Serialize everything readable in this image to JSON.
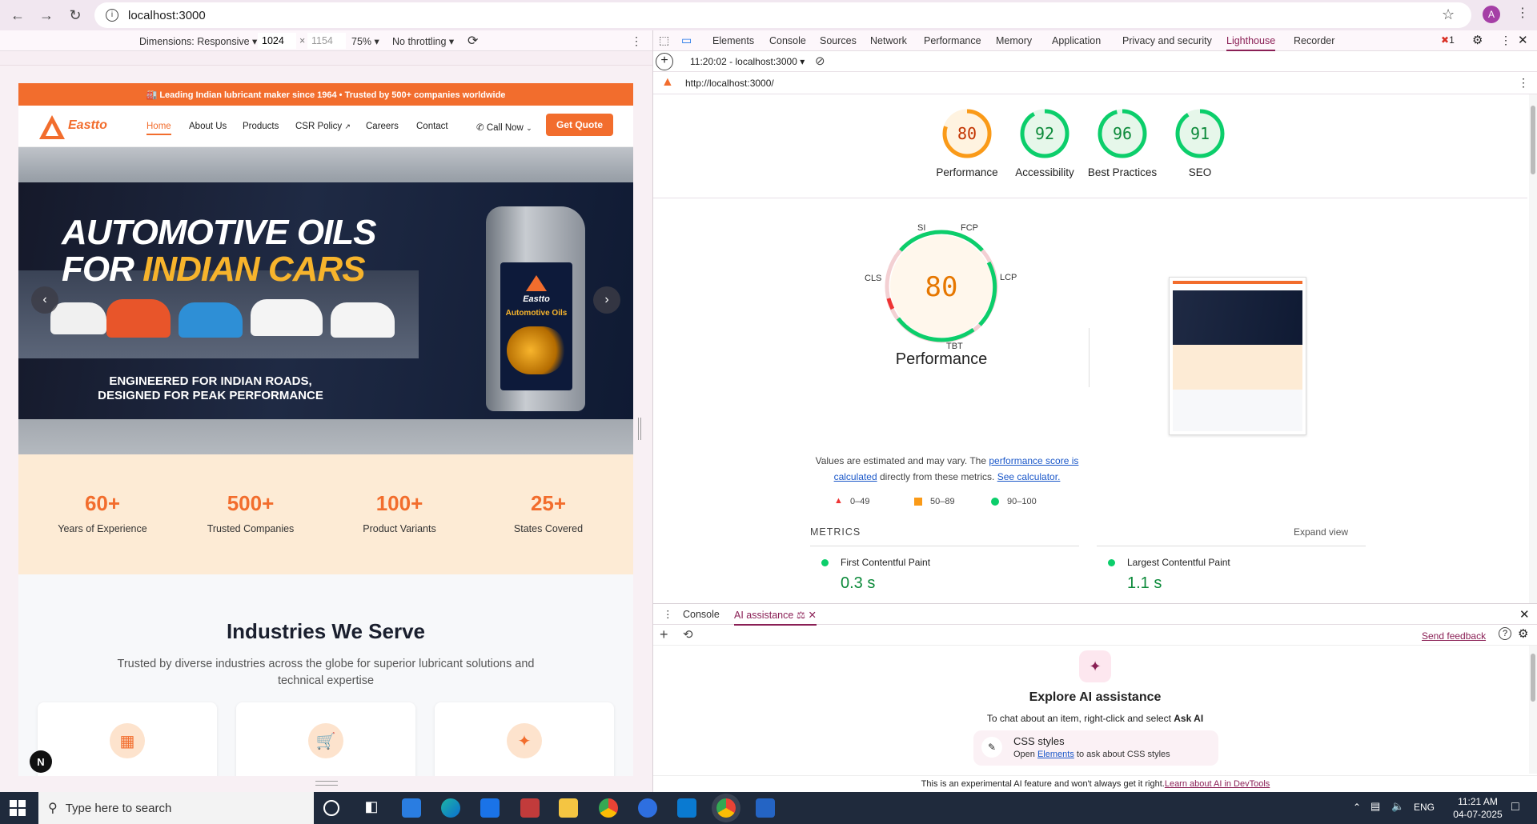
{
  "browser": {
    "url": "localhost:3000"
  },
  "device_toolbar": {
    "dimensions_label": "Dimensions: Responsive",
    "width": "1024",
    "height": "1154",
    "zoom": "75%",
    "throttling": "No throttling"
  },
  "site": {
    "announcement": "🏭 Leading Indian lubricant maker since 1964  • Trusted by 500+ companies worldwide",
    "logo_text": "Eastto",
    "nav": [
      "Home",
      "About Us",
      "Products",
      "CSR Policy",
      "Careers",
      "Contact"
    ],
    "call_now": "Call Now",
    "get_quote": "Get Quote",
    "hero": {
      "line1": "AUTOMOTIVE OILS",
      "line2_prefix": "FOR ",
      "line2_accent": "INDIAN CARS",
      "sub1": "ENGINEERED FOR INDIAN ROADS,",
      "sub2": "DESIGNED FOR PEAK PERFORMANCE",
      "bottle_brand": "Eastto",
      "bottle_label": "Automotive Oils"
    },
    "stats": [
      {
        "num": "60+",
        "label": "Years of Experience"
      },
      {
        "num": "500+",
        "label": "Trusted Companies"
      },
      {
        "num": "100+",
        "label": "Product Variants"
      },
      {
        "num": "25+",
        "label": "States Covered"
      }
    ],
    "industries": {
      "title": "Industries We Serve",
      "subtitle": "Trusted by diverse industries across the globe for superior lubricant solutions and technical expertise"
    },
    "next_badge": "N"
  },
  "devtools": {
    "tabs": [
      "Elements",
      "Console",
      "Sources",
      "Network",
      "Performance",
      "Memory",
      "Application",
      "Privacy and security",
      "Lighthouse",
      "Recorder"
    ],
    "active_tab": "Lighthouse",
    "error_count": "1",
    "report_select": "11:20:02 - localhost:3000",
    "report_url": "http://localhost:3000/",
    "scores": [
      {
        "value": "80",
        "label": "Performance",
        "color": "#fa9a18"
      },
      {
        "value": "92",
        "label": "Accessibility",
        "color": "#0cce6b"
      },
      {
        "value": "96",
        "label": "Best Practices",
        "color": "#0cce6b"
      },
      {
        "value": "91",
        "label": "SEO",
        "color": "#0cce6b"
      }
    ],
    "perf": {
      "score": "80",
      "title": "Performance",
      "labels": {
        "si": "SI",
        "fcp": "FCP",
        "lcp": "LCP",
        "tbt": "TBT",
        "cls": "CLS"
      },
      "note_prefix": "Values are estimated and may vary. The ",
      "note_link1": "performance score is calculated",
      "note_mid": " directly from these metrics. ",
      "note_link2": "See calculator.",
      "legend": [
        "0–49",
        "50–89",
        "90–100"
      ]
    },
    "metrics": {
      "title": "METRICS",
      "expand": "Expand view",
      "items": [
        {
          "name": "First Contentful Paint",
          "value": "0.3 s"
        },
        {
          "name": "Largest Contentful Paint",
          "value": "1.1 s"
        }
      ]
    },
    "drawer": {
      "tabs": [
        "Console",
        "AI assistance"
      ],
      "send_feedback": "Send feedback",
      "ai_title": "Explore AI assistance",
      "ai_hint_prefix": "To chat about an item, right-click and select ",
      "ai_hint_bold": "Ask AI",
      "css_title": "CSS styles",
      "css_text_prefix": "Open ",
      "css_text_link": "Elements",
      "css_text_suffix": " to ask about CSS styles",
      "footer_prefix": "This is an experimental AI feature and won't always get it right.",
      "footer_link": "Learn about AI in DevTools"
    }
  },
  "taskbar": {
    "search_placeholder": "Type here to search",
    "lang": "ENG",
    "time": "11:21 AM",
    "date": "04-07-2025"
  }
}
